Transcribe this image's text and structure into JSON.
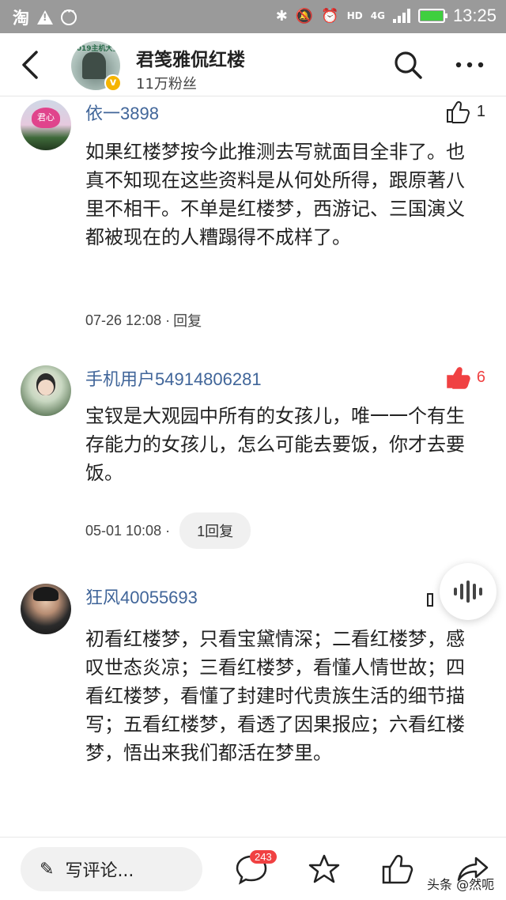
{
  "status_bar": {
    "app_icon_text": "淘",
    "network": "4G",
    "hd": "HD",
    "time": "13:25"
  },
  "header": {
    "account_name": "君笺雅侃红楼",
    "fans": "11万粉丝",
    "avatar_text": "2019主机大全",
    "verified_mark": "v"
  },
  "comments": [
    {
      "user": "依一3898",
      "avatar_text": "君心",
      "text": "如果红楼梦按今此推测去写就面目全非了。也真不知现在这些资料是从何处所得，跟原著八里不相干。不单是红楼梦，西游记、三国演义都被现在的人糟蹋得不成样了。",
      "time": "07-26 12:08 · ",
      "reply": "回复",
      "likes": "1",
      "liked": false
    },
    {
      "user": "手机用户54914806281",
      "text": "宝钗是大观园中所有的女孩儿，唯一一个有生存能力的女孩儿，怎么可能去要饭，你才去要饭。",
      "time": "05-01 10:08 · ",
      "reply": "1回复",
      "likes": "6",
      "liked": true
    },
    {
      "user": "狂风40055693",
      "text": "初看红楼梦，只看宝黛情深；二看红楼梦，感叹世态炎凉；三看红楼梦，看懂人情世故；四看红楼梦，看懂了封建时代贵族生活的细节描写；五看红楼梦，看透了因果报应；六看红楼梦，悟出来我们都活在梦里。",
      "time": "",
      "reply": "",
      "likes": "",
      "liked": false
    }
  ],
  "bottom_bar": {
    "write_placeholder": "写评论...",
    "comment_count": "243",
    "watermark": "头条 @然呃"
  },
  "colors": {
    "username": "#406599",
    "liked": "#f04142",
    "status_bar": "#9a9a9a"
  }
}
